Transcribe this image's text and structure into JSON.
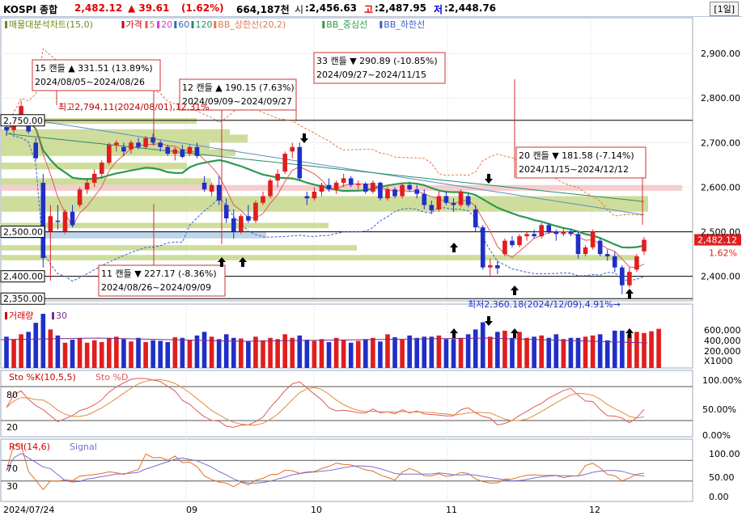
{
  "header": {
    "name": "KOSPI 종합",
    "price": "2,482.12",
    "change": "▲ 39.61",
    "pct": "(1.62%)",
    "volume": "664,187천",
    "open_label": "시",
    "open": ":2,456.63",
    "high_label": "고",
    "high": ":2,487.95",
    "low_label": "저",
    "low": ":2,448.76",
    "period": "[1일]"
  },
  "legend_main": {
    "items": [
      "매물대분석차트(15,0)",
      "가격",
      "5",
      "20",
      "60",
      "120",
      "BB_상한선(20,2)",
      "BB_중심선",
      "BB_하한선"
    ]
  },
  "legend_vol": {
    "items": [
      "거래량",
      "30"
    ]
  },
  "legend_sto": {
    "items": [
      "Sto %K(10,5,5)",
      "Sto %D"
    ]
  },
  "legend_rsi": {
    "items": [
      "RSI(14,6)",
      "Signal"
    ]
  },
  "annotations": [
    {
      "line1": "15 캔들 ▲ 331.51 (13.89%)",
      "line2": "2024/08/05~2024/08/26"
    },
    {
      "line1": "33 캔들 ▼ 290.89 (-10.85%)",
      "line2": "2024/09/27~2024/11/15"
    },
    {
      "line1": "12 캔들 ▲ 190.15 (7.63%)",
      "line2": "2024/09/09~2024/09/27"
    },
    {
      "line1": "20 캔들 ▼ 181.58 (-7.14%)",
      "line2": "2024/11/15~2024/12/12"
    },
    {
      "line1": "11 캔들 ▼ 227.17 (-8.36%)",
      "line2": "2024/08/26~2024/09/09"
    }
  ],
  "high_note": "최고2,794.11(2024/08/01),12.31%",
  "low_note": "최저2,360.18(2024/12/09),4.91%→",
  "price_boxes": [
    "2,750.00",
    "2,500.00",
    "2,400.00",
    "2,350.00"
  ],
  "last_price_box": "2,482.12",
  "last_pct_box": "1.62%",
  "chart_data": {
    "type": "candlestick",
    "price_axis": {
      "ticks": [
        "2,900.00",
        "2,800.00",
        "2,700.00",
        "2,600.00",
        "2,500.00",
        "2,400.00"
      ],
      "ylim": [
        2345,
        2980
      ]
    },
    "volume_axis": {
      "ticks": [
        "600,000",
        "400,000",
        "200,000",
        "X1000"
      ]
    },
    "sto_axis": {
      "ticks": [
        "100.00%",
        "50.00%",
        "0.00%"
      ],
      "levels": [
        "80",
        "20"
      ]
    },
    "rsi_axis": {
      "ticks": [
        "100.00",
        "50.00",
        "0.00"
      ],
      "levels": [
        "70",
        "30"
      ]
    },
    "x_labels": [
      "2024/07/24",
      "09",
      "10",
      "11",
      "12"
    ],
    "candles": [
      {
        "o": 2735,
        "h": 2745,
        "l": 2715,
        "c": 2728
      },
      {
        "o": 2728,
        "h": 2760,
        "l": 2720,
        "c": 2755
      },
      {
        "o": 2760,
        "h": 2794,
        "l": 2755,
        "c": 2782
      },
      {
        "o": 2760,
        "h": 2762,
        "l": 2720,
        "c": 2725
      },
      {
        "o": 2700,
        "h": 2710,
        "l": 2660,
        "c": 2665
      },
      {
        "o": 2610,
        "h": 2630,
        "l": 2420,
        "c": 2441
      },
      {
        "o": 2500,
        "h": 2560,
        "l": 2390,
        "c": 2535
      },
      {
        "o": 2525,
        "h": 2560,
        "l": 2505,
        "c": 2522
      },
      {
        "o": 2500,
        "h": 2550,
        "l": 2495,
        "c": 2545
      },
      {
        "o": 2545,
        "h": 2560,
        "l": 2510,
        "c": 2515
      },
      {
        "o": 2560,
        "h": 2600,
        "l": 2555,
        "c": 2595
      },
      {
        "o": 2595,
        "h": 2620,
        "l": 2585,
        "c": 2610
      },
      {
        "o": 2610,
        "h": 2640,
        "l": 2600,
        "c": 2630
      },
      {
        "o": 2630,
        "h": 2660,
        "l": 2620,
        "c": 2655
      },
      {
        "o": 2655,
        "h": 2700,
        "l": 2650,
        "c": 2695
      },
      {
        "o": 2695,
        "h": 2705,
        "l": 2680,
        "c": 2700
      },
      {
        "o": 2690,
        "h": 2700,
        "l": 2670,
        "c": 2680
      },
      {
        "o": 2685,
        "h": 2705,
        "l": 2675,
        "c": 2700
      },
      {
        "o": 2700,
        "h": 2710,
        "l": 2685,
        "c": 2690
      },
      {
        "o": 2690,
        "h": 2715,
        "l": 2685,
        "c": 2710
      },
      {
        "o": 2712,
        "h": 2720,
        "l": 2695,
        "c": 2700
      },
      {
        "o": 2700,
        "h": 2705,
        "l": 2680,
        "c": 2690
      },
      {
        "o": 2690,
        "h": 2695,
        "l": 2670,
        "c": 2675
      },
      {
        "o": 2675,
        "h": 2690,
        "l": 2660,
        "c": 2685
      },
      {
        "o": 2685,
        "h": 2695,
        "l": 2665,
        "c": 2668
      },
      {
        "o": 2675,
        "h": 2695,
        "l": 2670,
        "c": 2690
      },
      {
        "o": 2690,
        "h": 2700,
        "l": 2665,
        "c": 2670
      },
      {
        "o": 2610,
        "h": 2625,
        "l": 2590,
        "c": 2595
      },
      {
        "o": 2590,
        "h": 2610,
        "l": 2580,
        "c": 2605
      },
      {
        "o": 2605,
        "h": 2625,
        "l": 2560,
        "c": 2570
      },
      {
        "o": 2560,
        "h": 2575,
        "l": 2520,
        "c": 2530
      },
      {
        "o": 2530,
        "h": 2550,
        "l": 2485,
        "c": 2500
      },
      {
        "o": 2500,
        "h": 2540,
        "l": 2495,
        "c": 2535
      },
      {
        "o": 2535,
        "h": 2560,
        "l": 2520,
        "c": 2525
      },
      {
        "o": 2525,
        "h": 2570,
        "l": 2520,
        "c": 2565
      },
      {
        "o": 2565,
        "h": 2590,
        "l": 2560,
        "c": 2580
      },
      {
        "o": 2580,
        "h": 2620,
        "l": 2575,
        "c": 2615
      },
      {
        "o": 2615,
        "h": 2640,
        "l": 2600,
        "c": 2630
      },
      {
        "o": 2635,
        "h": 2680,
        "l": 2630,
        "c": 2675
      },
      {
        "o": 2680,
        "h": 2700,
        "l": 2665,
        "c": 2690
      },
      {
        "o": 2690,
        "h": 2700,
        "l": 2615,
        "c": 2620
      },
      {
        "o": 2580,
        "h": 2590,
        "l": 2560,
        "c": 2575
      },
      {
        "o": 2575,
        "h": 2600,
        "l": 2570,
        "c": 2590
      },
      {
        "o": 2590,
        "h": 2610,
        "l": 2580,
        "c": 2605
      },
      {
        "o": 2605,
        "h": 2620,
        "l": 2590,
        "c": 2595
      },
      {
        "o": 2595,
        "h": 2615,
        "l": 2585,
        "c": 2610
      },
      {
        "o": 2610,
        "h": 2630,
        "l": 2600,
        "c": 2620
      },
      {
        "o": 2620,
        "h": 2625,
        "l": 2600,
        "c": 2605
      },
      {
        "o": 2605,
        "h": 2615,
        "l": 2595,
        "c": 2608
      },
      {
        "o": 2608,
        "h": 2612,
        "l": 2585,
        "c": 2590
      },
      {
        "o": 2590,
        "h": 2615,
        "l": 2585,
        "c": 2610
      },
      {
        "o": 2610,
        "h": 2612,
        "l": 2570,
        "c": 2575
      },
      {
        "o": 2575,
        "h": 2600,
        "l": 2570,
        "c": 2595
      },
      {
        "o": 2595,
        "h": 2600,
        "l": 2575,
        "c": 2580
      },
      {
        "o": 2580,
        "h": 2610,
        "l": 2575,
        "c": 2605
      },
      {
        "o": 2605,
        "h": 2612,
        "l": 2590,
        "c": 2595
      },
      {
        "o": 2595,
        "h": 2605,
        "l": 2575,
        "c": 2585
      },
      {
        "o": 2585,
        "h": 2595,
        "l": 2550,
        "c": 2560
      },
      {
        "o": 2560,
        "h": 2570,
        "l": 2540,
        "c": 2548
      },
      {
        "o": 2550,
        "h": 2590,
        "l": 2545,
        "c": 2580
      },
      {
        "o": 2580,
        "h": 2590,
        "l": 2560,
        "c": 2565
      },
      {
        "o": 2565,
        "h": 2575,
        "l": 2545,
        "c": 2560
      },
      {
        "o": 2560,
        "h": 2595,
        "l": 2555,
        "c": 2590
      },
      {
        "o": 2580,
        "h": 2585,
        "l": 2555,
        "c": 2560
      },
      {
        "o": 2550,
        "h": 2560,
        "l": 2500,
        "c": 2510
      },
      {
        "o": 2510,
        "h": 2515,
        "l": 2415,
        "c": 2420
      },
      {
        "o": 2420,
        "h": 2440,
        "l": 2400,
        "c": 2425
      },
      {
        "o": 2425,
        "h": 2435,
        "l": 2405,
        "c": 2418
      },
      {
        "o": 2450,
        "h": 2485,
        "l": 2445,
        "c": 2480
      },
      {
        "o": 2480,
        "h": 2490,
        "l": 2465,
        "c": 2470
      },
      {
        "o": 2470,
        "h": 2495,
        "l": 2465,
        "c": 2490
      },
      {
        "o": 2490,
        "h": 2500,
        "l": 2480,
        "c": 2495
      },
      {
        "o": 2495,
        "h": 2505,
        "l": 2485,
        "c": 2490
      },
      {
        "o": 2490,
        "h": 2520,
        "l": 2485,
        "c": 2515
      },
      {
        "o": 2515,
        "h": 2520,
        "l": 2495,
        "c": 2500
      },
      {
        "o": 2500,
        "h": 2505,
        "l": 2480,
        "c": 2495
      },
      {
        "o": 2495,
        "h": 2510,
        "l": 2490,
        "c": 2500
      },
      {
        "o": 2500,
        "h": 2505,
        "l": 2490,
        "c": 2495
      },
      {
        "o": 2495,
        "h": 2500,
        "l": 2440,
        "c": 2450
      },
      {
        "o": 2450,
        "h": 2470,
        "l": 2445,
        "c": 2465
      },
      {
        "o": 2465,
        "h": 2505,
        "l": 2460,
        "c": 2500
      },
      {
        "o": 2480,
        "h": 2485,
        "l": 2445,
        "c": 2450
      },
      {
        "o": 2450,
        "h": 2460,
        "l": 2435,
        "c": 2445
      },
      {
        "o": 2445,
        "h": 2455,
        "l": 2410,
        "c": 2420
      },
      {
        "o": 2420,
        "h": 2425,
        "l": 2360,
        "c": 2380
      },
      {
        "o": 2380,
        "h": 2420,
        "l": 2375,
        "c": 2410
      },
      {
        "o": 2415,
        "h": 2450,
        "l": 2410,
        "c": 2445
      },
      {
        "o": 2456,
        "h": 2488,
        "l": 2448,
        "c": 2482
      }
    ],
    "volume": [
      520,
      480,
      560,
      600,
      750,
      900,
      640,
      540,
      420,
      470,
      500,
      420,
      460,
      430,
      500,
      520,
      480,
      440,
      500,
      430,
      460,
      450,
      430,
      510,
      500,
      470,
      540,
      600,
      520,
      480,
      560,
      500,
      490,
      440,
      520,
      460,
      500,
      480,
      560,
      500,
      540,
      470,
      450,
      480,
      430,
      500,
      470,
      420,
      450,
      480,
      500,
      440,
      560,
      510,
      470,
      540,
      500,
      520,
      520,
      540,
      480,
      480,
      500,
      560,
      640,
      760,
      520,
      600,
      620,
      500,
      600,
      500,
      520,
      540,
      500,
      560,
      480,
      500,
      500,
      520,
      540,
      560,
      460,
      620,
      620,
      560,
      600,
      580,
      610,
      650
    ]
  }
}
